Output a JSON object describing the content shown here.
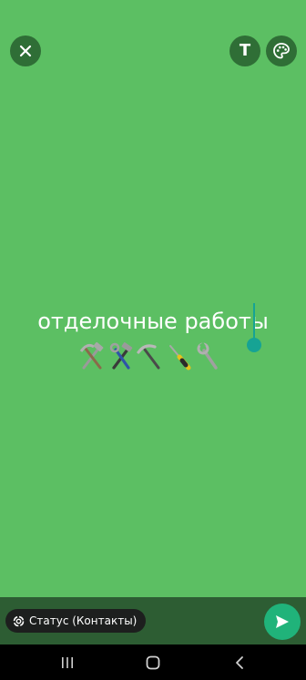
{
  "editor": {
    "background_color": "#5cbf63",
    "status_text": "отделочные работы",
    "emojis": [
      "hammer-and-pick",
      "hammer-and-wrench",
      "pick",
      "screwdriver",
      "wrench"
    ]
  },
  "toolbar": {
    "close_icon": "close-icon",
    "text_button_label": "T",
    "palette_icon": "palette-icon"
  },
  "footer": {
    "audience_label": "Статус (Контакты)",
    "audience_icon": "status-ring-icon",
    "send_icon": "send-icon",
    "accent": "#20b37a"
  },
  "navigation": {
    "items": [
      "recents-icon",
      "home-icon",
      "back-icon"
    ]
  }
}
